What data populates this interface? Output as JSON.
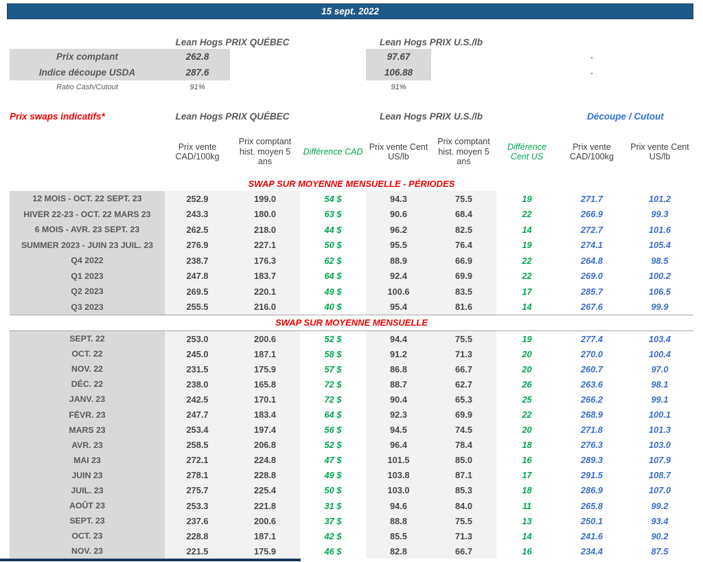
{
  "banner": {
    "date": "15 sept. 2022"
  },
  "colors": {
    "banner_bg": "#1F5988",
    "accent_red": "#EE0000",
    "accent_green": "#00A651",
    "accent_blue_values": "#3A6CC8",
    "cutout_header_blue": "#2D72D9",
    "label_column_bg": "#D9D9D9",
    "data_cell_bg": "#F2F2F2"
  },
  "spot": {
    "qc_header": "Lean Hogs PRIX QUÉBEC",
    "us_header": "Lean Hogs PRIX U.S./lb",
    "rows": [
      {
        "label": "Prix comptant",
        "qc": "262.8",
        "us": "97.67",
        "cutout_cad": "-"
      },
      {
        "label": "Indice découpe USDA",
        "qc": "287.6",
        "us": "106.88",
        "cutout_cad": "-"
      }
    ],
    "ratio": {
      "label": "Ratio Cash/Cutout",
      "qc": "91%",
      "us": "91%"
    }
  },
  "swaps": {
    "section_label": "Prix swaps indicatifs*",
    "qc_header": "Lean Hogs PRIX QUÉBEC",
    "us_header": "Lean Hogs PRIX U.S./lb",
    "cutout_header": "Découpe / Cutout",
    "columns": [
      "Prix vente CAD/100kg",
      "Prix comptant hist. moyen 5 ans",
      "Différence CAD",
      "Prix vente Cent US/lb",
      "Prix comptant hist. moyen 5 ans",
      "Différence Cent US",
      "Prix vente CAD/100kg",
      "Prix vente Cent US/lb"
    ],
    "sections": [
      {
        "title": "SWAP SUR MOYENNE MENSUELLE - PÉRIODES",
        "rows": [
          {
            "label": "12 MOIS - OCT. 22 SEPT. 23",
            "vente_cad": "252.9",
            "hist_cad": "199.0",
            "diff_cad": "54 $",
            "vente_us": "94.3",
            "hist_us": "75.5",
            "diff_us": "19",
            "cutout_cad": "271.7",
            "cutout_us": "101.2"
          },
          {
            "label": "HIVER 22-23 - OCT. 22 MARS 23",
            "vente_cad": "243.3",
            "hist_cad": "180.0",
            "diff_cad": "63 $",
            "vente_us": "90.6",
            "hist_us": "68.4",
            "diff_us": "22",
            "cutout_cad": "266.9",
            "cutout_us": "99.3"
          },
          {
            "label": "6 MOIS - AVR. 23 SEPT. 23",
            "vente_cad": "262.5",
            "hist_cad": "218.0",
            "diff_cad": "44 $",
            "vente_us": "96.2",
            "hist_us": "82.5",
            "diff_us": "14",
            "cutout_cad": "272.7",
            "cutout_us": "101.6"
          },
          {
            "label": "SUMMER 2023 - JUIN 23 JUIL. 23",
            "vente_cad": "276.9",
            "hist_cad": "227.1",
            "diff_cad": "50 $",
            "vente_us": "95.5",
            "hist_us": "76.4",
            "diff_us": "19",
            "cutout_cad": "274.1",
            "cutout_us": "105.4"
          },
          {
            "label": "Q4 2022",
            "vente_cad": "238.7",
            "hist_cad": "176.3",
            "diff_cad": "62 $",
            "vente_us": "88.9",
            "hist_us": "66.9",
            "diff_us": "22",
            "cutout_cad": "264.8",
            "cutout_us": "98.5"
          },
          {
            "label": "Q1 2023",
            "vente_cad": "247.8",
            "hist_cad": "183.7",
            "diff_cad": "64 $",
            "vente_us": "92.4",
            "hist_us": "69.9",
            "diff_us": "22",
            "cutout_cad": "269.0",
            "cutout_us": "100.2"
          },
          {
            "label": "Q2 2023",
            "vente_cad": "269.5",
            "hist_cad": "220.1",
            "diff_cad": "49 $",
            "vente_us": "100.6",
            "hist_us": "83.5",
            "diff_us": "17",
            "cutout_cad": "285.7",
            "cutout_us": "106.5"
          },
          {
            "label": "Q3 2023",
            "vente_cad": "255.5",
            "hist_cad": "216.0",
            "diff_cad": "40 $",
            "vente_us": "95.4",
            "hist_us": "81.6",
            "diff_us": "14",
            "cutout_cad": "267.6",
            "cutout_us": "99.9"
          }
        ]
      },
      {
        "title": "SWAP SUR MOYENNE MENSUELLE",
        "rows": [
          {
            "label": "SEPT. 22",
            "vente_cad": "253.0",
            "hist_cad": "200.6",
            "diff_cad": "52 $",
            "vente_us": "94.4",
            "hist_us": "75.5",
            "diff_us": "19",
            "cutout_cad": "277.4",
            "cutout_us": "103.4"
          },
          {
            "label": "OCT. 22",
            "vente_cad": "245.0",
            "hist_cad": "187.1",
            "diff_cad": "58 $",
            "vente_us": "91.2",
            "hist_us": "71.3",
            "diff_us": "20",
            "cutout_cad": "270.0",
            "cutout_us": "100.4"
          },
          {
            "label": "NOV. 22",
            "vente_cad": "231.5",
            "hist_cad": "175.9",
            "diff_cad": "57 $",
            "vente_us": "86.8",
            "hist_us": "66.7",
            "diff_us": "20",
            "cutout_cad": "260.7",
            "cutout_us": "97.0"
          },
          {
            "label": "DÉC. 22",
            "vente_cad": "238.0",
            "hist_cad": "165.8",
            "diff_cad": "72 $",
            "vente_us": "88.7",
            "hist_us": "62.7",
            "diff_us": "26",
            "cutout_cad": "263.6",
            "cutout_us": "98.1"
          },
          {
            "label": "JANV. 23",
            "vente_cad": "242.5",
            "hist_cad": "170.1",
            "diff_cad": "72 $",
            "vente_us": "90.4",
            "hist_us": "65.3",
            "diff_us": "25",
            "cutout_cad": "266.2",
            "cutout_us": "99.1"
          },
          {
            "label": "FÉVR. 23",
            "vente_cad": "247.7",
            "hist_cad": "183.4",
            "diff_cad": "64 $",
            "vente_us": "92.3",
            "hist_us": "69.9",
            "diff_us": "22",
            "cutout_cad": "268.9",
            "cutout_us": "100.1"
          },
          {
            "label": "MARS 23",
            "vente_cad": "253.4",
            "hist_cad": "197.4",
            "diff_cad": "56 $",
            "vente_us": "94.5",
            "hist_us": "74.5",
            "diff_us": "20",
            "cutout_cad": "271.8",
            "cutout_us": "101.3"
          },
          {
            "label": "AVR. 23",
            "vente_cad": "258.5",
            "hist_cad": "206.8",
            "diff_cad": "52 $",
            "vente_us": "96.4",
            "hist_us": "78.4",
            "diff_us": "18",
            "cutout_cad": "276.3",
            "cutout_us": "103.0"
          },
          {
            "label": "MAI 23",
            "vente_cad": "272.1",
            "hist_cad": "224.8",
            "diff_cad": "47 $",
            "vente_us": "101.5",
            "hist_us": "85.0",
            "diff_us": "16",
            "cutout_cad": "289.3",
            "cutout_us": "107.9"
          },
          {
            "label": "JUIN 23",
            "vente_cad": "278.1",
            "hist_cad": "228.8",
            "diff_cad": "49 $",
            "vente_us": "103.8",
            "hist_us": "87.1",
            "diff_us": "17",
            "cutout_cad": "291.5",
            "cutout_us": "108.7"
          },
          {
            "label": "JUIL. 23",
            "vente_cad": "275.7",
            "hist_cad": "225.4",
            "diff_cad": "50 $",
            "vente_us": "103.0",
            "hist_us": "85.3",
            "diff_us": "18",
            "cutout_cad": "286.9",
            "cutout_us": "107.0"
          },
          {
            "label": "AOÛT 23",
            "vente_cad": "253.3",
            "hist_cad": "221.8",
            "diff_cad": "31 $",
            "vente_us": "94.6",
            "hist_us": "84.0",
            "diff_us": "11",
            "cutout_cad": "265.8",
            "cutout_us": "99.2"
          },
          {
            "label": "SEPT. 23",
            "vente_cad": "237.6",
            "hist_cad": "200.6",
            "diff_cad": "37 $",
            "vente_us": "88.8",
            "hist_us": "75.5",
            "diff_us": "13",
            "cutout_cad": "250.1",
            "cutout_us": "93.4"
          },
          {
            "label": "OCT. 23",
            "vente_cad": "228.8",
            "hist_cad": "187.1",
            "diff_cad": "42 $",
            "vente_us": "85.5",
            "hist_us": "71.3",
            "diff_us": "14",
            "cutout_cad": "241.6",
            "cutout_us": "90.2"
          },
          {
            "label": "NOV. 23",
            "vente_cad": "221.5",
            "hist_cad": "175.9",
            "diff_cad": "46 $",
            "vente_us": "82.8",
            "hist_us": "66.7",
            "diff_us": "16",
            "cutout_cad": "234.4",
            "cutout_us": "87.5"
          }
        ]
      }
    ]
  }
}
